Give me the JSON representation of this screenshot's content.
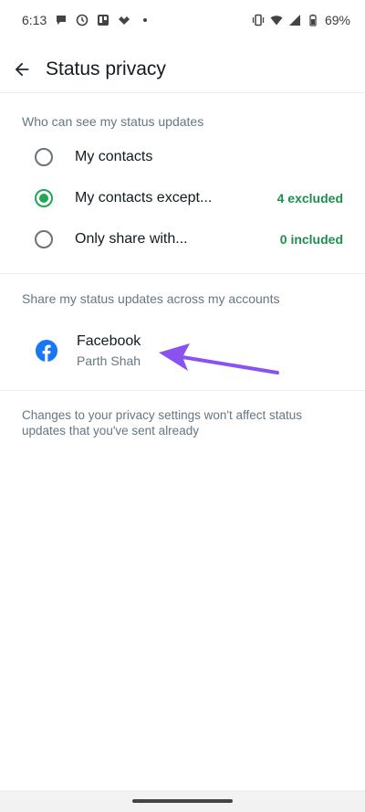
{
  "status_bar": {
    "time": "6:13",
    "battery": "69%",
    "left_icons": [
      "chat-bubble-icon",
      "clock-icon",
      "trello-icon",
      "tidal-icon",
      "dot-icon"
    ],
    "right_icons": [
      "vibrate-icon",
      "wifi-icon",
      "signal-icon",
      "battery-icon"
    ]
  },
  "app_bar": {
    "title": "Status privacy",
    "back_icon": "arrow-back-icon"
  },
  "privacy": {
    "heading": "Who can see my status updates",
    "options": [
      {
        "label": "My contacts",
        "selected": false,
        "meta": ""
      },
      {
        "label": "My contacts except...",
        "selected": true,
        "meta": "4 excluded"
      },
      {
        "label": "Only share with...",
        "selected": false,
        "meta": "0 included"
      }
    ]
  },
  "sharing": {
    "heading": "Share my status updates across my accounts",
    "account": {
      "title": "Facebook",
      "subtitle": "Parth Shah",
      "icon": "facebook-icon"
    }
  },
  "footer": {
    "note": "Changes to your privacy settings won't affect status updates that you've sent already"
  },
  "colors": {
    "accent": "#1fa855",
    "meta_text": "#1e8e4f",
    "facebook": "#1877f2",
    "annotation_arrow": "#8a52f0"
  }
}
